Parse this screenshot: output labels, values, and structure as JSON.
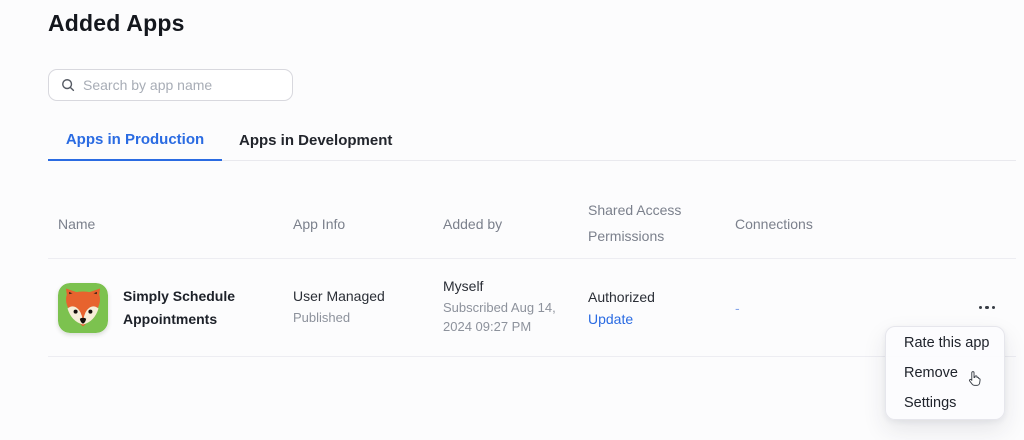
{
  "page": {
    "title": "Added Apps"
  },
  "search": {
    "placeholder": "Search by app name"
  },
  "tabs": [
    {
      "label": "Apps in Production",
      "active": true
    },
    {
      "label": "Apps in Development",
      "active": false
    }
  ],
  "table": {
    "columns": [
      "Name",
      "App Info",
      "Added by",
      "Shared Access Permissions",
      "Connections"
    ],
    "rows": [
      {
        "name": "Simply Schedule Appointments",
        "app_info": {
          "type": "User Managed",
          "status": "Published"
        },
        "added_by": {
          "who": "Myself",
          "subscribed": "Subscribed Aug 14, 2024 09:27 PM"
        },
        "shared_access": {
          "status": "Authorized",
          "action": "Update"
        },
        "connections": "-"
      }
    ]
  },
  "menu": {
    "items": [
      "Rate this app",
      "Remove",
      "Settings"
    ]
  },
  "icons": {
    "row_icon": "fox-app-icon",
    "search": "search-icon",
    "overflow": "ellipsis-menu-icon",
    "cursor": "hand-pointer-cursor"
  },
  "colors": {
    "accent_blue": "#2a6be2",
    "connections_dash_blue": "#86a6ea",
    "icon_green": "#7cc24f",
    "icon_orange": "#e7632e",
    "divider": "#ededf2"
  }
}
